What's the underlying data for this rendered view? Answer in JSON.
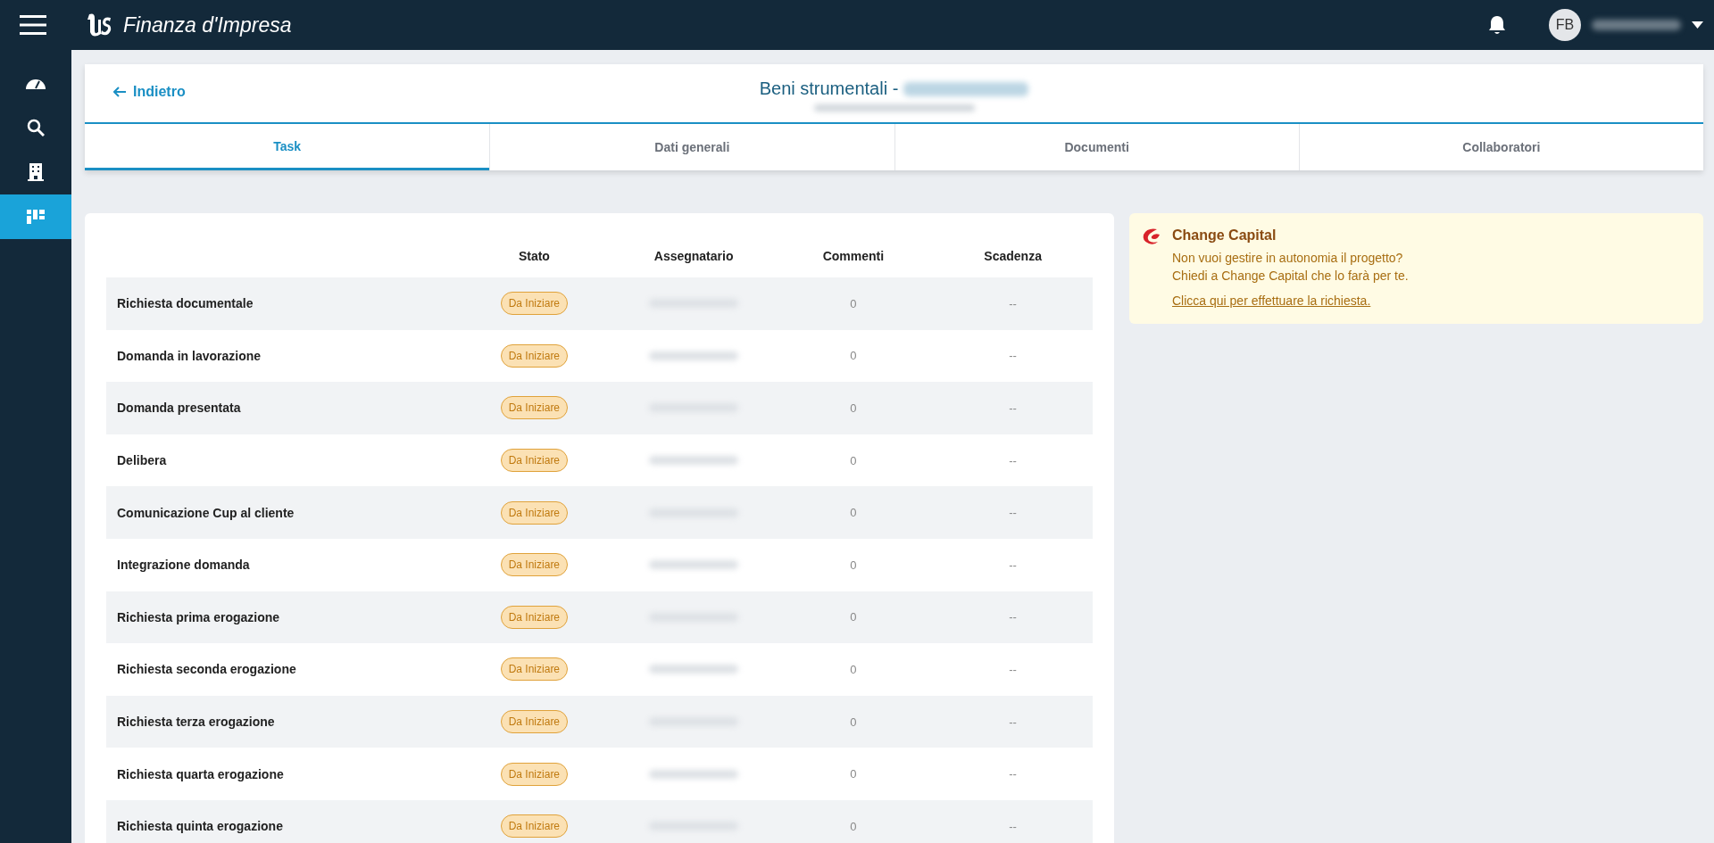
{
  "app_bar": {
    "title": "Finanza d'Impresa",
    "avatar_initials": "FB"
  },
  "sidebar": {
    "items": [
      {
        "kind": "gauge",
        "selected": false
      },
      {
        "kind": "search",
        "selected": false
      },
      {
        "kind": "building",
        "selected": false
      },
      {
        "kind": "board",
        "selected": true
      }
    ]
  },
  "header": {
    "back_link": "Indietro",
    "title": "Beni strumentali -"
  },
  "tabs": [
    {
      "label": "Task",
      "selected": true
    },
    {
      "label": "Dati generali",
      "selected": false
    },
    {
      "label": "Documenti",
      "selected": false
    },
    {
      "label": "Collaboratori",
      "selected": false
    }
  ],
  "table": {
    "columns": [
      "Stato",
      "Assegnatario",
      "Commenti",
      "Scadenza"
    ],
    "rows": [
      {
        "name": "Richiesta documentale",
        "status": "Da Iniziare",
        "comments": "0",
        "due": "--"
      },
      {
        "name": "Domanda in lavorazione",
        "status": "Da Iniziare",
        "comments": "0",
        "due": "--"
      },
      {
        "name": "Domanda presentata",
        "status": "Da Iniziare",
        "comments": "0",
        "due": "--"
      },
      {
        "name": "Delibera",
        "status": "Da Iniziare",
        "comments": "0",
        "due": "--"
      },
      {
        "name": "Comunicazione Cup al cliente",
        "status": "Da Iniziare",
        "comments": "0",
        "due": "--"
      },
      {
        "name": "Integrazione domanda",
        "status": "Da Iniziare",
        "comments": "0",
        "due": "--"
      },
      {
        "name": "Richiesta prima erogazione",
        "status": "Da Iniziare",
        "comments": "0",
        "due": "--"
      },
      {
        "name": "Richiesta seconda erogazione",
        "status": "Da Iniziare",
        "comments": "0",
        "due": "--"
      },
      {
        "name": "Richiesta terza erogazione",
        "status": "Da Iniziare",
        "comments": "0",
        "due": "--"
      },
      {
        "name": "Richiesta quarta erogazione",
        "status": "Da Iniziare",
        "comments": "0",
        "due": "--"
      },
      {
        "name": "Richiesta quinta erogazione",
        "status": "Da Iniziare",
        "comments": "0",
        "due": "--"
      }
    ]
  },
  "promo": {
    "title": "Change Capital",
    "lines": [
      "Non vuoi gestire in autonomia il progetto?",
      "Chiedi a Change Capital che lo farà per te."
    ],
    "link": "Clicca qui per effettuare la richiesta."
  }
}
